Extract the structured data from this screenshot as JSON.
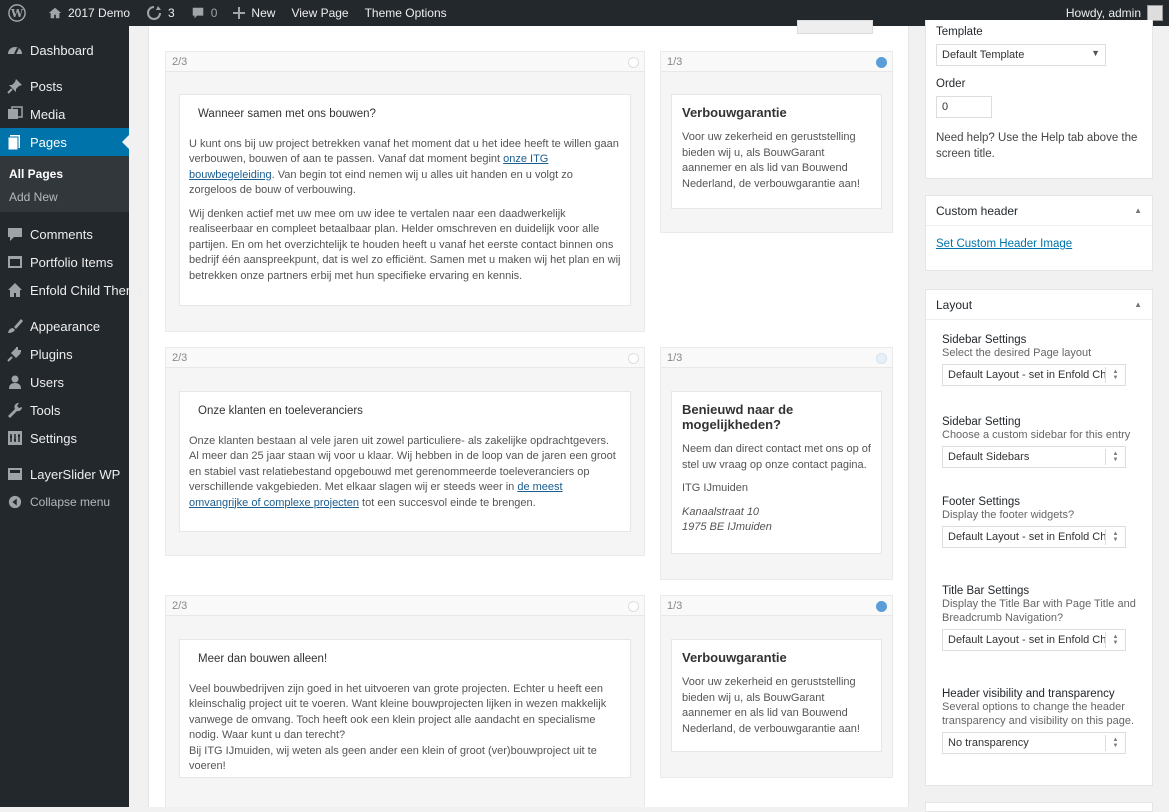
{
  "adminbar": {
    "site_name": "2017 Demo",
    "updates_count": "3",
    "comments_count": "0",
    "new_label": "New",
    "view_page": "View Page",
    "theme_options": "Theme Options",
    "howdy": "Howdy, admin"
  },
  "sidebar": {
    "dashboard": "Dashboard",
    "posts": "Posts",
    "media": "Media",
    "pages": "Pages",
    "all_pages": "All Pages",
    "add_new": "Add New",
    "comments": "Comments",
    "portfolio": "Portfolio Items",
    "enfold_child": "Enfold Child Theme",
    "appearance": "Appearance",
    "plugins": "Plugins",
    "users": "Users",
    "tools": "Tools",
    "settings": "Settings",
    "layerslider": "LayerSlider WP",
    "collapse": "Collapse menu"
  },
  "rows": [
    {
      "left_size": "2/3",
      "right_size": "1/3",
      "left_title": "Wanneer samen met ons bouwen?",
      "left_p1_a": "U kunt ons bij uw project betrekken vanaf het moment dat u het idee heeft te willen gaan verbouwen, bouwen of aan te passen. Vanaf dat moment begint ",
      "left_p1_link": "onze ITG bouwbegeleiding",
      "left_p1_b": ". Van begin tot eind nemen wij u alles uit handen en u volgt zo zorgeloos de bouw of verbouwing.",
      "left_p2": "Wij denken actief met uw mee om uw idee te vertalen naar een daadwerkelijk realiseerbaar en compleet betaalbaar plan. Helder omschreven en duidelijk voor alle partijen. En om het overzichtelijk te houden heeft u vanaf het eerste contact binnen ons bedrijf één aanspreekpunt, dat is wel zo efficiënt. Samen met u maken wij het plan en wij betrekken onze partners erbij met hun specifieke ervaring en kennis.",
      "right_title": "Verbouwgarantie",
      "right_text": "Voor uw zekerheid en geruststelling bieden wij u, als BouwGarant aannemer en als lid van Bouwend Nederland, de verbouwgarantie aan!"
    },
    {
      "left_size": "2/3",
      "right_size": "1/3",
      "left_title": "Onze klanten en toeleveranciers",
      "left_p1_a": "Onze klanten bestaan al vele jaren uit zowel particuliere- als zakelijke opdrachtgevers. Al meer dan 25 jaar staan wij voor u klaar. Wij hebben in de loop van de jaren een groot en stabiel vast relatiebestand opgebouwd met gerenommeerde toeleveranciers op verschillende vakgebieden. Met elkaar slagen wij er steeds weer in ",
      "left_p1_link": "de meest omvangrijke of complexe projecten",
      "left_p1_b": " tot een succesvol einde te brengen.",
      "right_title": "Benieuwd naar de mogelijkheden?",
      "right_text": "Neem dan direct contact met ons op of stel uw vraag op onze contact pagina.",
      "right_company": "ITG IJmuiden",
      "right_address1": "Kanaalstraat 10",
      "right_address2": "1975 BE IJmuiden"
    },
    {
      "left_size": "2/3",
      "right_size": "1/3",
      "left_title": "Meer dan bouwen alleen!",
      "left_p1": "Veel bouwbedrijven zijn goed in het uitvoeren van grote projecten. Echter u heeft een kleinschalig project uit te voeren. Want kleine bouwprojecten lijken in wezen makkelijk vanwege de omvang. Toch heeft ook een klein project alle aandacht en specialisme nodig. Waar kunt u dan terecht?",
      "left_p1_b": "Bij ITG IJmuiden, wij weten als geen ander een klein of groot (ver)bouwproject uit te voeren!",
      "right_title": "Verbouwgarantie",
      "right_text": "Voor uw zekerheid en geruststelling bieden wij u, als BouwGarant aannemer en als lid van Bouwend Nederland, de verbouwgarantie aan!"
    }
  ],
  "attributes": {
    "template_label": "Template",
    "template_value": "Default Template",
    "order_label": "Order",
    "order_value": "0",
    "help_text": "Need help? Use the Help tab above the screen title."
  },
  "custom_header": {
    "title": "Custom header",
    "link": "Set Custom Header Image"
  },
  "layout": {
    "title": "Layout",
    "sections": [
      {
        "title": "Sidebar Settings",
        "desc": "Select the desired Page layout",
        "value": "Default Layout - set in Enfold Ch"
      },
      {
        "title": "Sidebar Setting",
        "desc": "Choose a custom sidebar for this entry",
        "value": "Default Sidebars"
      },
      {
        "title": "Footer Settings",
        "desc": "Display the footer widgets?",
        "value": "Default Layout - set in Enfold Ch"
      },
      {
        "title": "Title Bar Settings",
        "desc": "Display the Title Bar with Page Title and Breadcrumb Navigation?",
        "value": "Default Layout - set in Enfold Ch"
      },
      {
        "title": "Header visibility and transparency",
        "desc": "Several options to change the header transparency and visibility on this page.",
        "value": "No transparency"
      }
    ]
  }
}
